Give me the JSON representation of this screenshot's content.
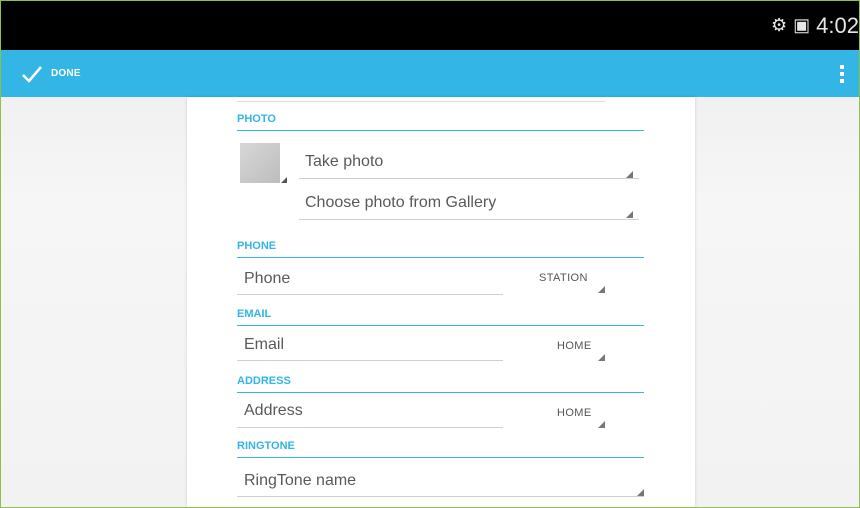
{
  "status_bar": {
    "time": "4:02",
    "icons": [
      "android-debug-icon",
      "screenshot-icon"
    ]
  },
  "action_bar": {
    "done_label": "DONE",
    "accent_color": "#33b5e5"
  },
  "form": {
    "photo": {
      "header": "PHOTO",
      "take_photo": "Take photo",
      "choose_gallery": "Choose photo from Gallery"
    },
    "phone": {
      "header": "PHONE",
      "placeholder": "Phone",
      "type": "STATION"
    },
    "email": {
      "header": "EMAIL",
      "placeholder": "Email",
      "type": "HOME"
    },
    "address": {
      "header": "ADDRESS",
      "placeholder": "Address",
      "type": "HOME"
    },
    "ringtone": {
      "header": "RINGTONE",
      "value": "RingTone name"
    }
  }
}
